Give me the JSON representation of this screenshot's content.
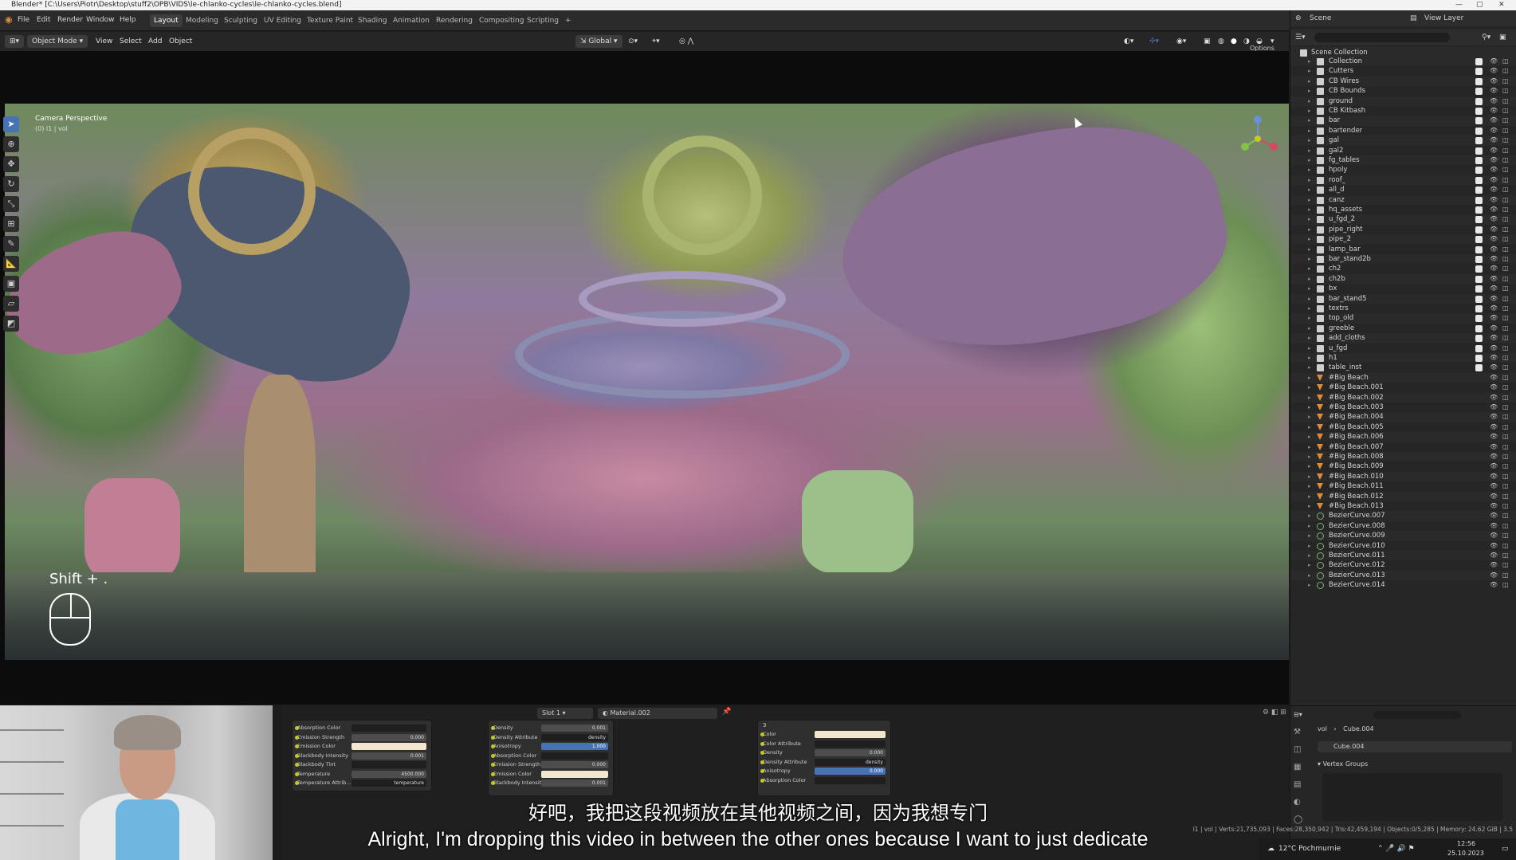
{
  "window": {
    "title": "Blender* [C:\\Users\\Piotr\\Desktop\\stuff2\\OPB\\VIDS\\le-chlanko-cycles\\le-chlanko-cycles.blend]"
  },
  "menu": [
    "File",
    "Edit",
    "Render",
    "Window",
    "Help"
  ],
  "workspaces": [
    "Layout",
    "Modeling",
    "Sculpting",
    "UV Editing",
    "Texture Paint",
    "Shading",
    "Animation",
    "Rendering",
    "Compositing",
    "Scripting"
  ],
  "top_right": {
    "scene": "Scene",
    "view_layer": "View Layer"
  },
  "viewport_header": {
    "mode": "Object Mode",
    "view": "View",
    "select": "Select",
    "add": "Add",
    "object": "Object",
    "transform": "Global",
    "options": "Options"
  },
  "viewport": {
    "title": "Camera Perspective",
    "subtitle": "(0) l1 | vol",
    "shift_hint": "Shift + ."
  },
  "tools": [
    "cursor",
    "move",
    "rotate",
    "scale",
    "transform",
    "annotate",
    "measure",
    "add-cube",
    "shear",
    "edit"
  ],
  "outliner": {
    "root": "Scene Collection",
    "items": [
      {
        "name": "Collection",
        "type": "coll"
      },
      {
        "name": "Cutters",
        "type": "coll"
      },
      {
        "name": "CB Wires",
        "type": "coll"
      },
      {
        "name": "CB Bounds",
        "type": "coll"
      },
      {
        "name": "ground",
        "type": "coll"
      },
      {
        "name": "CB Kitbash",
        "type": "coll"
      },
      {
        "name": "bar",
        "type": "coll"
      },
      {
        "name": "bartender",
        "type": "coll"
      },
      {
        "name": "gal",
        "type": "coll"
      },
      {
        "name": "gal2",
        "type": "coll"
      },
      {
        "name": "fg_tables",
        "type": "coll"
      },
      {
        "name": "hpoly",
        "type": "coll"
      },
      {
        "name": "roof_",
        "type": "coll"
      },
      {
        "name": "all_d",
        "type": "coll"
      },
      {
        "name": "canz",
        "type": "coll"
      },
      {
        "name": "hq_assets",
        "type": "coll"
      },
      {
        "name": "u_fgd_2",
        "type": "coll"
      },
      {
        "name": "pipe_right",
        "type": "coll"
      },
      {
        "name": "pipe_2",
        "type": "coll"
      },
      {
        "name": "lamp_bar",
        "type": "coll"
      },
      {
        "name": "bar_stand2b",
        "type": "coll"
      },
      {
        "name": "ch2",
        "type": "coll"
      },
      {
        "name": "ch2b",
        "type": "coll"
      },
      {
        "name": "bx",
        "type": "coll"
      },
      {
        "name": "bar_stand5",
        "type": "coll"
      },
      {
        "name": "textrs",
        "type": "coll"
      },
      {
        "name": "top_old",
        "type": "coll"
      },
      {
        "name": "greeble",
        "type": "coll"
      },
      {
        "name": "add_cloths",
        "type": "coll"
      },
      {
        "name": "u_fgd",
        "type": "coll"
      },
      {
        "name": "h1",
        "type": "coll"
      },
      {
        "name": "table_inst",
        "type": "coll"
      },
      {
        "name": "#Big Beach",
        "type": "obj"
      },
      {
        "name": "#Big Beach.001",
        "type": "obj"
      },
      {
        "name": "#Big Beach.002",
        "type": "obj"
      },
      {
        "name": "#Big Beach.003",
        "type": "obj"
      },
      {
        "name": "#Big Beach.004",
        "type": "obj"
      },
      {
        "name": "#Big Beach.005",
        "type": "obj"
      },
      {
        "name": "#Big Beach.006",
        "type": "obj"
      },
      {
        "name": "#Big Beach.007",
        "type": "obj"
      },
      {
        "name": "#Big Beach.008",
        "type": "obj"
      },
      {
        "name": "#Big Beach.009",
        "type": "obj"
      },
      {
        "name": "#Big Beach.010",
        "type": "obj"
      },
      {
        "name": "#Big Beach.011",
        "type": "obj"
      },
      {
        "name": "#Big Beach.012",
        "type": "obj"
      },
      {
        "name": "#Big Beach.013",
        "type": "obj"
      },
      {
        "name": "BezierCurve.007",
        "type": "crv"
      },
      {
        "name": "BezierCurve.008",
        "type": "crv"
      },
      {
        "name": "BezierCurve.009",
        "type": "crv"
      },
      {
        "name": "BezierCurve.010",
        "type": "crv"
      },
      {
        "name": "BezierCurve.011",
        "type": "crv"
      },
      {
        "name": "BezierCurve.012",
        "type": "crv"
      },
      {
        "name": "BezierCurve.013",
        "type": "crv"
      },
      {
        "name": "BezierCurve.014",
        "type": "crv"
      }
    ]
  },
  "properties": {
    "breadcrumb_a": "vol",
    "breadcrumb_b": "Cube.004",
    "object_field": "Cube.004",
    "panel": "Vertex Groups"
  },
  "node_editor": {
    "slot": "Slot 1",
    "material": "Material.002",
    "node1": [
      {
        "label": "Absorption Color",
        "value": "",
        "kind": "dark"
      },
      {
        "label": "Emission Strength",
        "value": "0.000",
        "kind": "grey"
      },
      {
        "label": "Emission Color",
        "value": "",
        "kind": "cream"
      },
      {
        "label": "Blackbody Intensity",
        "value": "0.001",
        "kind": "grey"
      },
      {
        "label": "Blackbody Tint",
        "value": "",
        "kind": "dark"
      },
      {
        "label": "Temperature",
        "value": "4500.000",
        "kind": "grey"
      },
      {
        "label": "Temperature Attrib...",
        "value": "temperature",
        "kind": "dark"
      }
    ],
    "node2": [
      {
        "label": "Density",
        "value": "0.001",
        "kind": "grey"
      },
      {
        "label": "Density Attribute",
        "value": "density",
        "kind": "dark"
      },
      {
        "label": "Anisotropy",
        "value": "1.000",
        "kind": "blue"
      },
      {
        "label": "Absorption Color",
        "value": "",
        "kind": "dark"
      },
      {
        "label": "Emission Strength",
        "value": "0.000",
        "kind": "grey"
      },
      {
        "label": "Emission Color",
        "value": "",
        "kind": "cream"
      },
      {
        "label": "Blackbody Intensity",
        "value": "0.001",
        "kind": "grey"
      }
    ],
    "node3_header": "3",
    "node3": [
      {
        "label": "Color",
        "value": "",
        "kind": "cream"
      },
      {
        "label": "Color Attribute",
        "value": "",
        "kind": "dark"
      },
      {
        "label": "Density",
        "value": "0.000",
        "kind": "grey"
      },
      {
        "label": "Density Attribute",
        "value": "density",
        "kind": "dark"
      },
      {
        "label": "Anisotropy",
        "value": "0.000",
        "kind": "blue"
      },
      {
        "label": "Absorption Color",
        "value": "",
        "kind": "dark"
      }
    ]
  },
  "subtitles": {
    "cn": "好吧，我把这段视频放在其他视频之间，因为我想专门",
    "en": "Alright, I'm dropping this video in between the other ones because I want to just dedicate"
  },
  "status": "l1 | vol | Verts:21,735,093 | Faces:28,350,942 | Tris:42,459,194 | Objects:0/5,285 | Memory: 24.62 GiB | 3.5",
  "taskbar": {
    "weather": "12°C Pochmurnie",
    "time": "12:56",
    "date": "25.10.2023"
  },
  "colors": {
    "accent": "#4772b3",
    "selected": "#4772b3"
  }
}
